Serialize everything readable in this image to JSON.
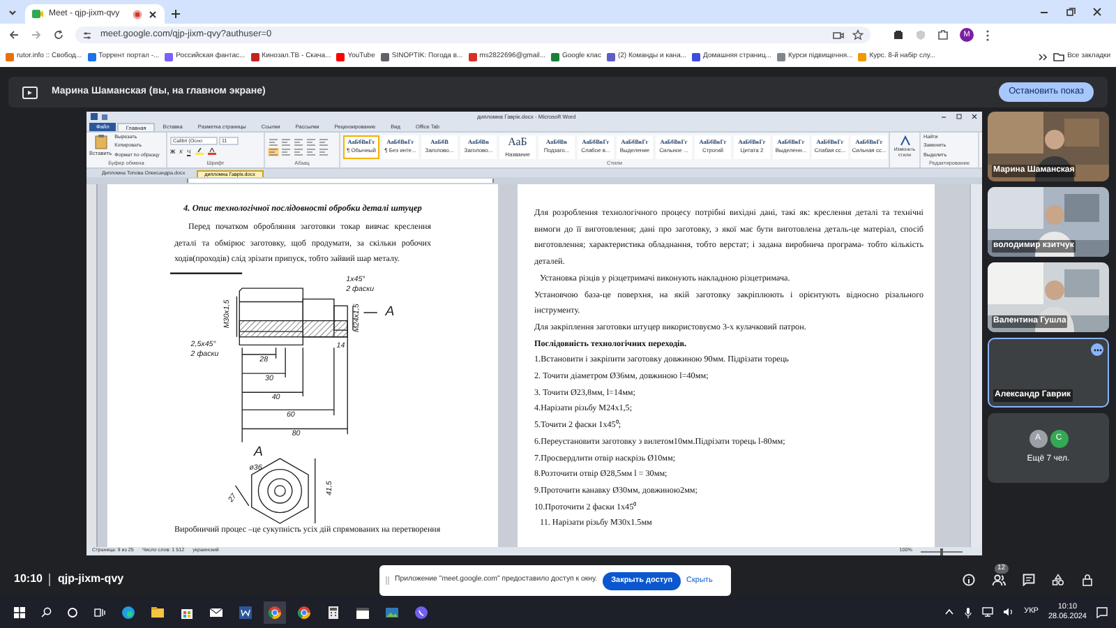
{
  "browser": {
    "tab": {
      "title": "Meet - qjp-jixm-qvy",
      "selected": true
    },
    "address": "meet.google.com/qjp-jixm-qvy?authuser=0",
    "profile": "M",
    "bookmarks": [
      {
        "label": "rutor.info :: Свобод...",
        "color": "#e8710a"
      },
      {
        "label": "Торрент портал -...",
        "color": "#1a73e8"
      },
      {
        "label": "Российская фантас...",
        "color": "#7b61ff"
      },
      {
        "label": "Кинозал.ТВ - Скача...",
        "color": "#c5221f"
      },
      {
        "label": "YouTube",
        "color": "#ff0000"
      },
      {
        "label": "SINOPTIK: Погода в...",
        "color": "#5f6368"
      },
      {
        "label": "ms2822696@gmail...",
        "color": "#d93025"
      },
      {
        "label": "Google клас",
        "color": "#188038"
      },
      {
        "label": "(2) Команды и кана...",
        "color": "#5b5fc7"
      },
      {
        "label": "Домашняя страниц...",
        "color": "#3c4fe0"
      },
      {
        "label": "Курси підвищення...",
        "color": "#80868b"
      },
      {
        "label": "Курс. 8-й набір слу...",
        "color": "#f29900"
      }
    ],
    "all_bookmarks": "Все закладки"
  },
  "banner": {
    "text": "Марина Шаманская (вы, на главном экране)",
    "button": "Остановить показ"
  },
  "word": {
    "title": "дипломна Гаврік.docx - Microsoft Word",
    "ribbon_tabs": [
      {
        "label": "Файл",
        "kind": "file",
        "selected": false
      },
      {
        "label": "Главная",
        "kind": "tab",
        "selected": true
      },
      {
        "label": "Вставка",
        "kind": "tab",
        "selected": false
      },
      {
        "label": "Разметка страницы",
        "kind": "tab",
        "selected": false
      },
      {
        "label": "Ссылки",
        "kind": "tab",
        "selected": false
      },
      {
        "label": "Рассылки",
        "kind": "tab",
        "selected": false
      },
      {
        "label": "Рецензирование",
        "kind": "tab",
        "selected": false
      },
      {
        "label": "Вид",
        "kind": "tab",
        "selected": false
      },
      {
        "label": "Office Tab",
        "kind": "tab",
        "selected": false
      }
    ],
    "clipboard": {
      "paste": "Вставить",
      "actions": [
        "Вырезать",
        "Копировать",
        "Формат по образцу"
      ],
      "group": "Буфер обмена"
    },
    "font": {
      "name": "Calibri (Осно",
      "size": "11",
      "buttons": [
        "Ж",
        "К",
        "Ч"
      ],
      "group": "Шрифт"
    },
    "paragraph": {
      "group": "Абзац"
    },
    "styles": {
      "group": "Стили",
      "items": [
        {
          "preview": "АаБбВвГг",
          "label": "¶ Обычный",
          "selected": true
        },
        {
          "preview": "АаБбВвГг",
          "label": "¶ Без инте...",
          "selected": false
        },
        {
          "preview": "АаБбВ",
          "label": "Заголово...",
          "selected": false
        },
        {
          "preview": "АаБбВв",
          "label": "Заголово...",
          "selected": false
        },
        {
          "preview": "АаБ",
          "label": "Название",
          "selected": false
        },
        {
          "preview": "АаБбВв",
          "label": "Подзаго...",
          "selected": false
        },
        {
          "preview": "АаБбВвГг",
          "label": "Слабое в...",
          "selected": false
        },
        {
          "preview": "АаБбВвГг",
          "label": "Выделение",
          "selected": false
        },
        {
          "preview": "АаБбВвГг",
          "label": "Сильное ...",
          "selected": false
        },
        {
          "preview": "АаБбВвГг",
          "label": "Строгий",
          "selected": false
        },
        {
          "preview": "АаБбВвГг",
          "label": "Цитата 2",
          "selected": false
        },
        {
          "preview": "АаБбВвГг",
          "label": "Выделенн...",
          "selected": false
        },
        {
          "preview": "АаБбВвГг",
          "label": "Слабая сс...",
          "selected": false
        },
        {
          "preview": "АаБбВвГг",
          "label": "Сильная сс...",
          "selected": false
        }
      ],
      "change": "Изменить стили"
    },
    "editing": {
      "actions": [
        "Найти",
        "Заменить",
        "Выделить"
      ],
      "group": "Редактирование"
    },
    "doc_tabs": [
      {
        "label": "Дипломна Топова Олександра.docx",
        "selected": false
      },
      {
        "label": "дипломна Гаврік.docx",
        "selected": true
      }
    ],
    "left_page": {
      "heading": "4. Опис технологічної послідовності обробки  деталі штуцер",
      "intro": "Перед початком  обробляння заготовки токар вивчає креслення деталі та обмірює заготовку, щоб продумати, за скільки робочих ходів(проходів) слід зрізати припуск, тобто зайвий шар металу.",
      "drawing_labels": [
        "1х45°",
        "2 фаски",
        "М30х1,5",
        "М24х1,5",
        "А",
        "2,5х45°",
        "2 фаски",
        "14",
        "28",
        "30",
        "40",
        "60",
        "80",
        "А",
        "ø36",
        "41,5",
        "27"
      ],
      "footer": "Виробничий процес –це сукупність усіх дій спрямованих на перетворення"
    },
    "right_page": [
      {
        "kind": "para",
        "text": "Для розроблення технологічного процесу потрібні вихідні дані, такі як: креслення деталі та технічні вимоги до її виготовлення; дані про заготовку, з якої має бути виготовлена деталь-це матеріал, спосіб виготовлення; характеристика обладнання, тобто верстат; і задана виробнича програма- тобто кількість деталей."
      },
      {
        "kind": "indent",
        "text": "Установка різців у різцетримачі виконують накладною різцетримача."
      },
      {
        "kind": "para",
        "text": "Установчою база-це поверхня, на якій заготовку закріплюють і орієнтують відносно різального інструменту."
      },
      {
        "kind": "line",
        "text": "Для закріплення заготовки штуцер використовуємо 3-х кулачковий патрон."
      },
      {
        "kind": "heading",
        "text": "Послідовність технологічних переходів."
      },
      {
        "kind": "line",
        "text": "1.Встановити і закріпити заготовку довжиною 90мм. Підрізати торець"
      },
      {
        "kind": "line",
        "text": "2. Точити діаметром Ø36мм, довжиною l=40мм;"
      },
      {
        "kind": "line",
        "text": "3. Точити Ø23,8мм, l=14мм;"
      },
      {
        "kind": "line",
        "text": "4.Нарізати різьбу М24х1,5;"
      },
      {
        "kind": "line",
        "text": "5.Точити 2 фаски 1х45⁰;"
      },
      {
        "kind": "line",
        "text": "6.Переустановити заготовку з вилетом10мм.Підрізати торець l-80мм;"
      },
      {
        "kind": "line",
        "text": "7.Просвердлити отвір наскрізь Ø10мм;"
      },
      {
        "kind": "line",
        "text": "8.Розточити отвір Ø28,5мм l = 30мм;"
      },
      {
        "kind": "line",
        "text": "9.Проточити канавку Ø30мм, довжиною2мм;"
      },
      {
        "kind": "line",
        "text": "10.Проточити 2 фаски 1х45⁰"
      },
      {
        "kind": "indent",
        "text": "11. Нарізати різьбу М30х1.5мм"
      }
    ],
    "status": {
      "page": "Страница: 9 из 25",
      "words": "Число слов: 1 512",
      "language": "украинский",
      "zoom": "100%",
      "zoom_slider": {
        "level": 0.5
      }
    }
  },
  "participants": [
    {
      "name": "Марина Шаманская",
      "kind": "video",
      "active": false
    },
    {
      "name": "володимир кзитчук",
      "kind": "video",
      "active": false
    },
    {
      "name": "Валентина Гушла",
      "kind": "video",
      "active": false
    },
    {
      "name": "Александр Гаврик",
      "kind": "tile",
      "active": true
    }
  ],
  "more": {
    "avatars": [
      {
        "letter": "А",
        "color": "#9aa0a6"
      },
      {
        "letter": "С",
        "color": "#34a853"
      }
    ],
    "label": "Ещё 7 чел."
  },
  "meeting_bar": {
    "time": "10:10",
    "code": "qjp-jixm-qvy",
    "people_count": "12"
  },
  "notice": {
    "text": "Приложение \"meet.google.com\" предоставило доступ к окну.",
    "button": "Закрыть доступ",
    "link": "Скрыть"
  },
  "taskbar": {
    "language": "УКР",
    "time": "10:10",
    "date": "28.06.2024"
  }
}
